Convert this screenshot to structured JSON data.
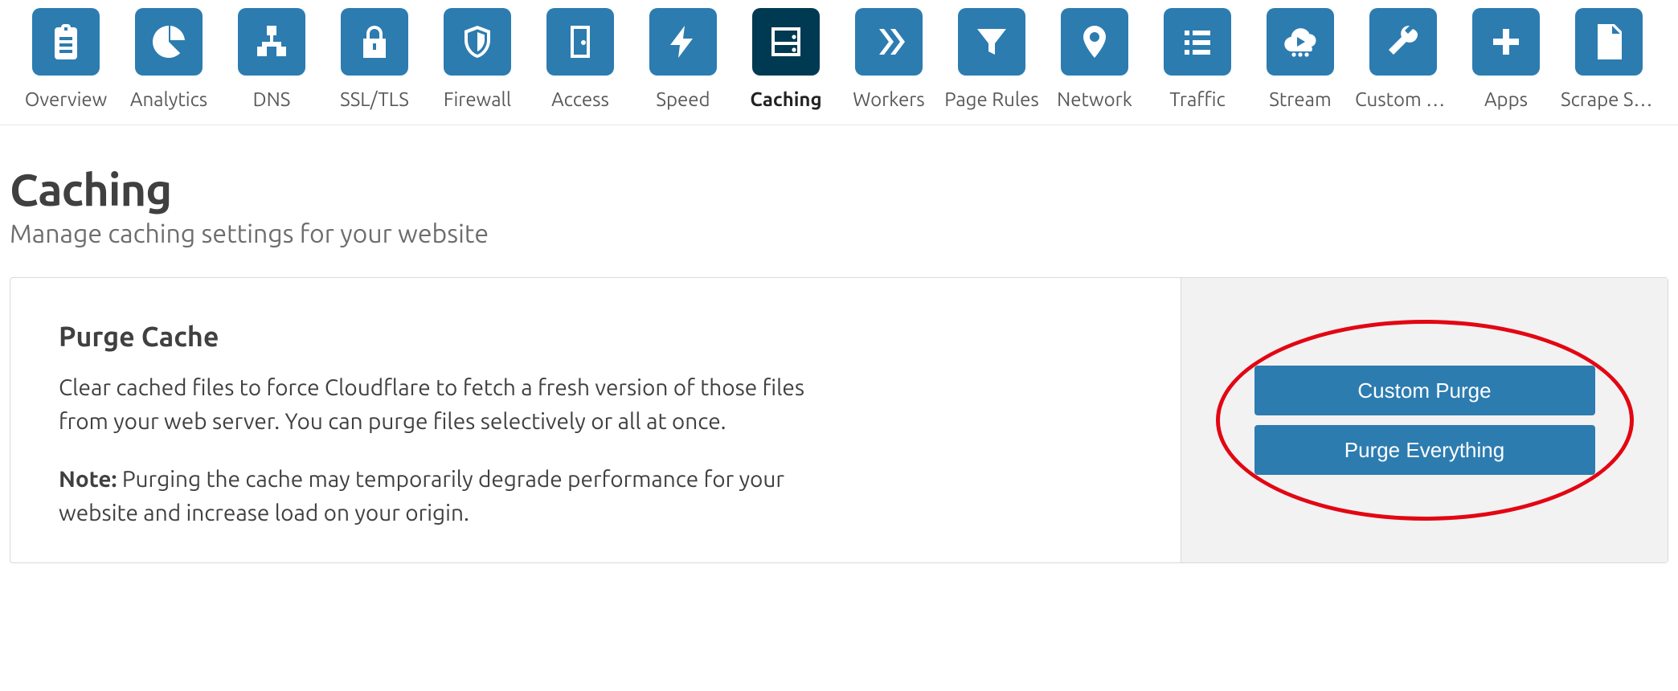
{
  "nav": {
    "items": [
      {
        "label": "Overview"
      },
      {
        "label": "Analytics"
      },
      {
        "label": "DNS"
      },
      {
        "label": "SSL/TLS"
      },
      {
        "label": "Firewall"
      },
      {
        "label": "Access"
      },
      {
        "label": "Speed"
      },
      {
        "label": "Caching"
      },
      {
        "label": "Workers"
      },
      {
        "label": "Page Rules"
      },
      {
        "label": "Network"
      },
      {
        "label": "Traffic"
      },
      {
        "label": "Stream"
      },
      {
        "label": "Custom P…"
      },
      {
        "label": "Apps"
      },
      {
        "label": "Scrape Sh…"
      }
    ]
  },
  "header": {
    "title": "Caching",
    "subtitle": "Manage caching settings for your website"
  },
  "purge_card": {
    "title": "Purge Cache",
    "description": "Clear cached files to force Cloudflare to fetch a fresh version of those files from your web server. You can purge files selectively or all at once.",
    "note_label": "Note:",
    "note_text": " Purging the cache may temporarily degrade performance for your website and increase load on your origin.",
    "custom_purge_label": "Custom Purge",
    "purge_everything_label": "Purge Everything"
  }
}
